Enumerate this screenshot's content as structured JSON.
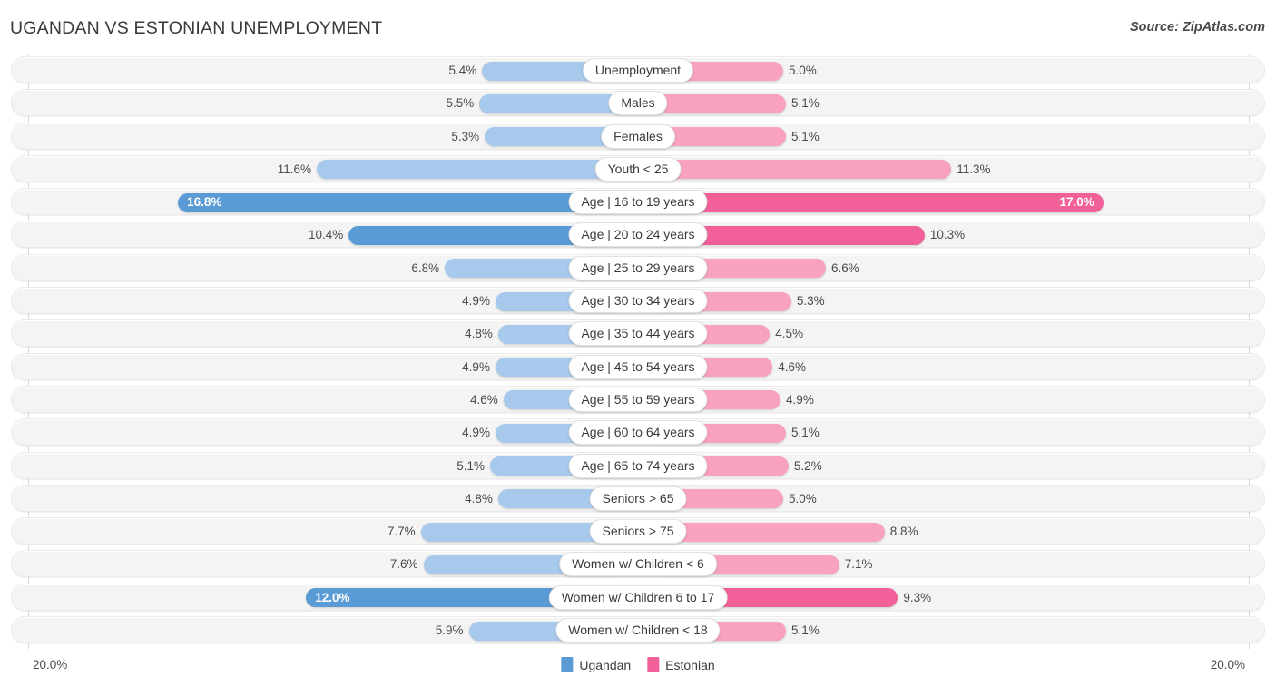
{
  "header": {
    "title": "UGANDAN VS ESTONIAN UNEMPLOYMENT",
    "source": "Source: ZipAtlas.com"
  },
  "axis": {
    "min_label": "20.0%",
    "max_label": "20.0%",
    "max_value": 20.0
  },
  "legend": {
    "items": [
      {
        "label": "Ugandan",
        "color": "#5b9bd5"
      },
      {
        "label": "Estonian",
        "color": "#f2609a"
      }
    ]
  },
  "colors": {
    "left_normal": "#a6c9ec",
    "right_normal": "#f8a1c0",
    "left_highlight": "#5b9bd5",
    "right_highlight": "#f2609a",
    "track": "#f4f4f4"
  },
  "chart_data": {
    "type": "bar",
    "title": "UGANDAN VS ESTONIAN UNEMPLOYMENT",
    "subtitle": "",
    "orientation": "horizontal-diverging",
    "xlabel": "",
    "ylabel": "",
    "xlim": [
      -20.0,
      20.0
    ],
    "grid": false,
    "legend_position": "bottom-center",
    "categories": [
      "Unemployment",
      "Males",
      "Females",
      "Youth < 25",
      "Age | 16 to 19 years",
      "Age | 20 to 24 years",
      "Age | 25 to 29 years",
      "Age | 30 to 34 years",
      "Age | 35 to 44 years",
      "Age | 45 to 54 years",
      "Age | 55 to 59 years",
      "Age | 60 to 64 years",
      "Age | 65 to 74 years",
      "Seniors > 65",
      "Seniors > 75",
      "Women w/ Children < 6",
      "Women w/ Children 6 to 17",
      "Women w/ Children < 18"
    ],
    "series": [
      {
        "name": "Ugandan",
        "values": [
          5.4,
          5.5,
          5.3,
          11.6,
          16.8,
          10.4,
          6.8,
          4.9,
          4.8,
          4.9,
          4.6,
          4.9,
          5.1,
          4.8,
          7.7,
          7.6,
          12.0,
          5.9
        ]
      },
      {
        "name": "Estonian",
        "values": [
          5.0,
          5.1,
          5.1,
          11.3,
          17.0,
          10.3,
          6.6,
          5.3,
          4.5,
          4.6,
          4.9,
          5.1,
          5.2,
          5.0,
          8.8,
          7.1,
          9.3,
          5.1
        ]
      }
    ]
  },
  "rows": [
    {
      "label": "Unemployment",
      "left": "5.4%",
      "right": "5.0%",
      "left_value": 5.4,
      "right_value": 5.0,
      "highlight": false,
      "left_inside": false,
      "right_inside": false
    },
    {
      "label": "Males",
      "left": "5.5%",
      "right": "5.1%",
      "left_value": 5.5,
      "right_value": 5.1,
      "highlight": false,
      "left_inside": false,
      "right_inside": false
    },
    {
      "label": "Females",
      "left": "5.3%",
      "right": "5.1%",
      "left_value": 5.3,
      "right_value": 5.1,
      "highlight": false,
      "left_inside": false,
      "right_inside": false
    },
    {
      "label": "Youth < 25",
      "left": "11.6%",
      "right": "11.3%",
      "left_value": 11.6,
      "right_value": 11.3,
      "highlight": false,
      "left_inside": false,
      "right_inside": false
    },
    {
      "label": "Age | 16 to 19 years",
      "left": "16.8%",
      "right": "17.0%",
      "left_value": 16.8,
      "right_value": 17.0,
      "highlight": true,
      "left_inside": true,
      "right_inside": true
    },
    {
      "label": "Age | 20 to 24 years",
      "left": "10.4%",
      "right": "10.3%",
      "left_value": 10.4,
      "right_value": 10.3,
      "highlight": true,
      "left_inside": false,
      "right_inside": false
    },
    {
      "label": "Age | 25 to 29 years",
      "left": "6.8%",
      "right": "6.6%",
      "left_value": 6.8,
      "right_value": 6.6,
      "highlight": false,
      "left_inside": false,
      "right_inside": false
    },
    {
      "label": "Age | 30 to 34 years",
      "left": "4.9%",
      "right": "5.3%",
      "left_value": 4.9,
      "right_value": 5.3,
      "highlight": false,
      "left_inside": false,
      "right_inside": false
    },
    {
      "label": "Age | 35 to 44 years",
      "left": "4.8%",
      "right": "4.5%",
      "left_value": 4.8,
      "right_value": 4.5,
      "highlight": false,
      "left_inside": false,
      "right_inside": false
    },
    {
      "label": "Age | 45 to 54 years",
      "left": "4.9%",
      "right": "4.6%",
      "left_value": 4.9,
      "right_value": 4.6,
      "highlight": false,
      "left_inside": false,
      "right_inside": false
    },
    {
      "label": "Age | 55 to 59 years",
      "left": "4.6%",
      "right": "4.9%",
      "left_value": 4.6,
      "right_value": 4.9,
      "highlight": false,
      "left_inside": false,
      "right_inside": false
    },
    {
      "label": "Age | 60 to 64 years",
      "left": "4.9%",
      "right": "5.1%",
      "left_value": 4.9,
      "right_value": 5.1,
      "highlight": false,
      "left_inside": false,
      "right_inside": false
    },
    {
      "label": "Age | 65 to 74 years",
      "left": "5.1%",
      "right": "5.2%",
      "left_value": 5.1,
      "right_value": 5.2,
      "highlight": false,
      "left_inside": false,
      "right_inside": false
    },
    {
      "label": "Seniors > 65",
      "left": "4.8%",
      "right": "5.0%",
      "left_value": 4.8,
      "right_value": 5.0,
      "highlight": false,
      "left_inside": false,
      "right_inside": false
    },
    {
      "label": "Seniors > 75",
      "left": "7.7%",
      "right": "8.8%",
      "left_value": 7.7,
      "right_value": 8.8,
      "highlight": false,
      "left_inside": false,
      "right_inside": false
    },
    {
      "label": "Women w/ Children < 6",
      "left": "7.6%",
      "right": "7.1%",
      "left_value": 7.6,
      "right_value": 7.1,
      "highlight": false,
      "left_inside": false,
      "right_inside": false
    },
    {
      "label": "Women w/ Children 6 to 17",
      "left": "12.0%",
      "right": "9.3%",
      "left_value": 12.0,
      "right_value": 9.3,
      "highlight": true,
      "left_inside": true,
      "right_inside": false
    },
    {
      "label": "Women w/ Children < 18",
      "left": "5.9%",
      "right": "5.1%",
      "left_value": 5.9,
      "right_value": 5.1,
      "highlight": false,
      "left_inside": false,
      "right_inside": false
    }
  ]
}
